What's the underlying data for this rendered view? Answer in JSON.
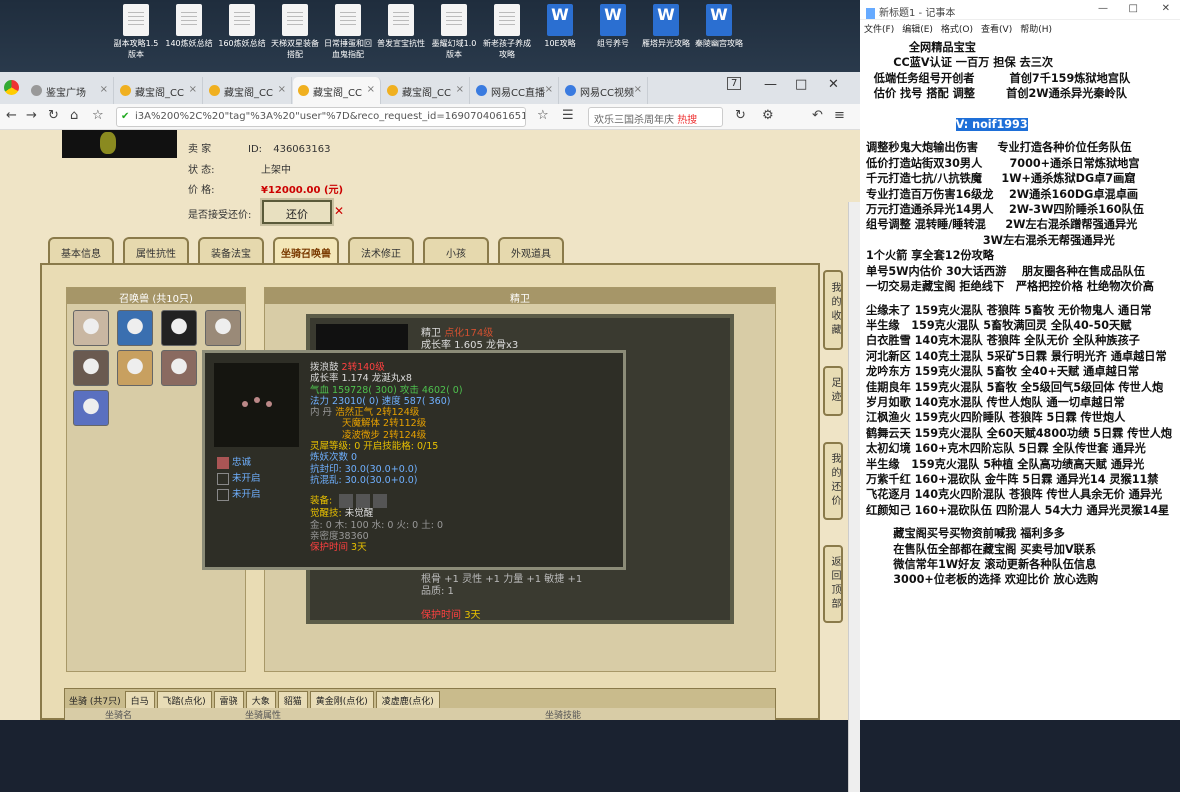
{
  "desktop": {
    "icons": [
      {
        "label": "副本攻略1.5版本",
        "type": "doc"
      },
      {
        "label": "140炼妖总结",
        "type": "doc"
      },
      {
        "label": "160炼妖总结",
        "type": "doc"
      },
      {
        "label": "天梯双星装备搭配",
        "type": "doc"
      },
      {
        "label": "日常捶蛋和回血鬼指配",
        "type": "doc"
      },
      {
        "label": "普发宣宝抗性",
        "type": "doc"
      },
      {
        "label": "墨耀幻域1.0版本",
        "type": "doc"
      },
      {
        "label": "新老孩子养成攻略",
        "type": "doc"
      },
      {
        "label": "10E攻略",
        "type": "word"
      },
      {
        "label": "组号养号",
        "type": "word"
      },
      {
        "label": "雁塔异光攻略",
        "type": "word"
      },
      {
        "label": "秦陵幽宫攻略",
        "type": "word"
      }
    ]
  },
  "browser": {
    "tabs": [
      {
        "label": "鉴宝广场"
      },
      {
        "label": "藏宝阁_CC"
      },
      {
        "label": "藏宝阁_CC"
      },
      {
        "label": "藏宝阁_CC"
      },
      {
        "label": "藏宝阁_CC"
      },
      {
        "label": "网易CC直播"
      },
      {
        "label": "网易CC视频"
      }
    ],
    "tab_count": "7",
    "url": "i3A%200%2C%20\"tag\"%3A%20\"user\"%7D&reco_request_id=1690704061651tByDb",
    "search_text": "欢乐三国杀周年庆",
    "hot_label": "热搜"
  },
  "listing": {
    "seller_label": "卖 家",
    "seller_id_label": "ID:",
    "seller_id": "436063163",
    "status_label": "状 态:",
    "status": "上架中",
    "price_label": "价 格:",
    "price": "¥12000.00 (元)",
    "bargain_label": "是否接受还价:",
    "bargain_button": "还价"
  },
  "page_tabs": [
    "基本信息",
    "属性抗性",
    "装备法宝",
    "坐骑召唤兽",
    "法术修正",
    "小孩",
    "外观道具"
  ],
  "active_tab": "坐骑召唤兽",
  "pets": {
    "header": "召唤兽 (共10只)",
    "icons": [
      "pet-avatar-1",
      "pet-avatar-2",
      "pet-avatar-3",
      "pet-avatar-4",
      "pet-avatar-5",
      "pet-avatar-6",
      "pet-avatar-7",
      "pet-avatar-8",
      "pet-avatar-9"
    ]
  },
  "detail": {
    "header": "精卫",
    "name": "精卫",
    "name_tag": "点化174级",
    "growth": "成长率 1.605 龙骨x3",
    "stats": "根骨 +1 灵性 +1 力量 +1 敏捷 +1",
    "quality": "品质: 1",
    "protect_label": "保护时间",
    "protect_value": "3天"
  },
  "tooltip": {
    "name": "拨浪鼓",
    "level": "2转140级",
    "growth": "成长率 1.174 龙涎丸x8",
    "qixue": "气血 159728( 300) 攻击 4602( 0)",
    "fali": "法力 23010( 0) 速度 587( 360)",
    "neidan_label": "内 丹",
    "neidan": [
      "浩然正气 2转124级",
      "天魔解体 2转112级",
      "凌波微步 2转124级"
    ],
    "lingxi": "灵犀等级: 0 开启技能格: 0/15",
    "lianyao": "炼妖次数 0",
    "kangfeng": "抗封印: 30.0(30.0+0.0)",
    "kanghun": "抗混乱: 30.0(30.0+0.0)",
    "zhuangbei_label": "装备:",
    "juexing_label": "觉醒技:",
    "juexing": "未觉醒",
    "wuxing": "金: 0 木: 100 水: 0 火: 0 土: 0",
    "qinmi": "亲密度38360",
    "protect": "保护时间",
    "protect_value": "3天",
    "skills": [
      "忠诚",
      "未开启",
      "未开启"
    ]
  },
  "bottom": {
    "label": "坐骑 (共7只)",
    "tabs": [
      "白马",
      "飞踏(点化)",
      "雷骁",
      "大象",
      "貂猫",
      "黄金刚(点化)",
      "凌虚鹿(点化)"
    ],
    "col1": "坐骑名",
    "col2": "坐骑属性",
    "col3": "坐骑技能"
  },
  "side_buttons": [
    "我的收藏",
    "足迹",
    "我的还价",
    "返回顶部"
  ],
  "notepad": {
    "title": "新标题1 - 记事本",
    "menu": [
      "文件(F)",
      "编辑(E)",
      "格式(O)",
      "查看(V)",
      "帮助(H)"
    ],
    "lines_head": [
      "           全网精品宝宝",
      "       CC蓝V认证 一百万 担保 去三次",
      "  低端任务组号开创者         首创7千159炼狱地宫队",
      "  估价 找号 搭配 调整        首创2W通杀异光秦岭队"
    ],
    "vid": "V: noif1993",
    "lines_body": [
      "",
      "调整秒鬼大炮输出伤害     专业打造各种价位任务队伍",
      "低价打造站街双30男人       7000+通杀日常炼狱地宫",
      "千元打造七抗/八抗铁魔     1W+通杀炼狱DG卓7画窟",
      "专业打造百万伤害16级龙    2W通杀160DG卓混卓画",
      "万元打造通杀异光14男人    2W-3W四阶睡杀160队伍",
      "组号调整 混转睡/睡转混     2W左右混杀蹭帮强通异光",
      "                              3W左右混杀无帮强通异光",
      "1个火箭 享全套12份攻略",
      "单号5W内估价 30大话西游    朋友圈各种在售成品队伍",
      "一切交易走藏宝阁 拒绝线下   严格把控价格 杜绝物次价高",
      "",
      "尘缘未了 159克火混队 苍狼阵 5畜牧 无价物鬼人 通日常",
      "半生缘   159克火混队 5畜牧满回灵 全队40-50天赋",
      "白衣胜雪 140克木混队 苍狼阵 全队无价 全队种族孩子",
      "河北新区 140克土混队 5采矿5日霖 景行明光齐 通卓越日常",
      "龙吟东方 159克火混队 5畜牧 全40+天赋 通卓越日常",
      "佳期良年 159克火混队 5畜牧 全5级回气5级回体 传世人炮",
      "岁月如歌 140克水混队 传世人炮队 通一切卓越日常",
      "江枫渔火 159克火四阶睡队 苍狼阵 5日霖 传世炮人",
      "鹤舞云天 159克火混队 全60天赋4800功绩 5日霖 传世人炮",
      "太初幻境 160+克木四阶忘队 5日霖 全队传世套 通异光",
      "半生缘   159克火混队 5种植 全队高功绩高天赋 通异光",
      "万紫千红 160+混砍队 金牛阵 5日霖 通异光14 灵猴11禁",
      "飞花逐月 140克火四阶混队 苍狼阵 传世人具余无价 通异光",
      "红颜知己 160+混砍队伍 四阶混人 54大力 通异光灵猴14星",
      "",
      "       藏宝阁买号买物资前喊我 福利多多",
      "       在售队伍全部都在藏宝阁 买卖号加V联系",
      "       微信常年1W好友 滚动更新各种队伍信息",
      "       3000+位老板的选择 欢迎比价 放心选购"
    ]
  }
}
